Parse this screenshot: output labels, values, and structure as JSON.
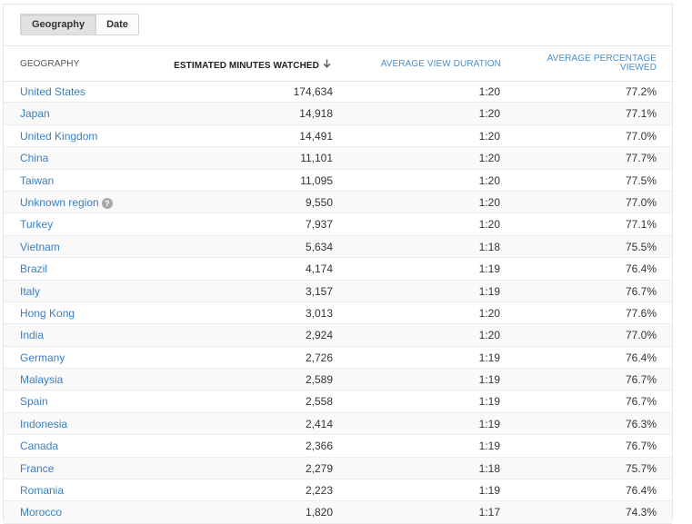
{
  "tabs": [
    {
      "label": "Geography",
      "active": true
    },
    {
      "label": "Date",
      "active": false
    }
  ],
  "columns": {
    "geography": "GEOGRAPHY",
    "minutes": "ESTIMATED MINUTES WATCHED",
    "sort_icon": "arrow-down-icon",
    "avg_duration": "AVERAGE VIEW DURATION",
    "avg_pct_line1": "AVERAGE PERCENTAGE",
    "avg_pct_line2": "VIEWED"
  },
  "colors": {
    "link": "#3b7fc0",
    "header_link": "#4a8fc8",
    "text": "#333333"
  },
  "rows": [
    {
      "geo": "United States",
      "minutes": "174,634",
      "duration": "1:20",
      "pct": "77.2%"
    },
    {
      "geo": "Japan",
      "minutes": "14,918",
      "duration": "1:20",
      "pct": "77.1%"
    },
    {
      "geo": "United Kingdom",
      "minutes": "14,491",
      "duration": "1:20",
      "pct": "77.0%"
    },
    {
      "geo": "China",
      "minutes": "11,101",
      "duration": "1:20",
      "pct": "77.7%"
    },
    {
      "geo": "Taiwan",
      "minutes": "11,095",
      "duration": "1:20",
      "pct": "77.5%"
    },
    {
      "geo": "Unknown region",
      "minutes": "9,550",
      "duration": "1:20",
      "pct": "77.0%",
      "help": "?"
    },
    {
      "geo": "Turkey",
      "minutes": "7,937",
      "duration": "1:20",
      "pct": "77.1%"
    },
    {
      "geo": "Vietnam",
      "minutes": "5,634",
      "duration": "1:18",
      "pct": "75.5%"
    },
    {
      "geo": "Brazil",
      "minutes": "4,174",
      "duration": "1:19",
      "pct": "76.4%"
    },
    {
      "geo": "Italy",
      "minutes": "3,157",
      "duration": "1:19",
      "pct": "76.7%"
    },
    {
      "geo": "Hong Kong",
      "minutes": "3,013",
      "duration": "1:20",
      "pct": "77.6%"
    },
    {
      "geo": "India",
      "minutes": "2,924",
      "duration": "1:20",
      "pct": "77.0%"
    },
    {
      "geo": "Germany",
      "minutes": "2,726",
      "duration": "1:19",
      "pct": "76.4%"
    },
    {
      "geo": "Malaysia",
      "minutes": "2,589",
      "duration": "1:19",
      "pct": "76.7%"
    },
    {
      "geo": "Spain",
      "minutes": "2,558",
      "duration": "1:19",
      "pct": "76.7%"
    },
    {
      "geo": "Indonesia",
      "minutes": "2,414",
      "duration": "1:19",
      "pct": "76.3%"
    },
    {
      "geo": "Canada",
      "minutes": "2,366",
      "duration": "1:19",
      "pct": "76.7%"
    },
    {
      "geo": "France",
      "minutes": "2,279",
      "duration": "1:18",
      "pct": "75.7%"
    },
    {
      "geo": "Romania",
      "minutes": "2,223",
      "duration": "1:19",
      "pct": "76.4%"
    },
    {
      "geo": "Morocco",
      "minutes": "1,820",
      "duration": "1:17",
      "pct": "74.3%"
    }
  ]
}
